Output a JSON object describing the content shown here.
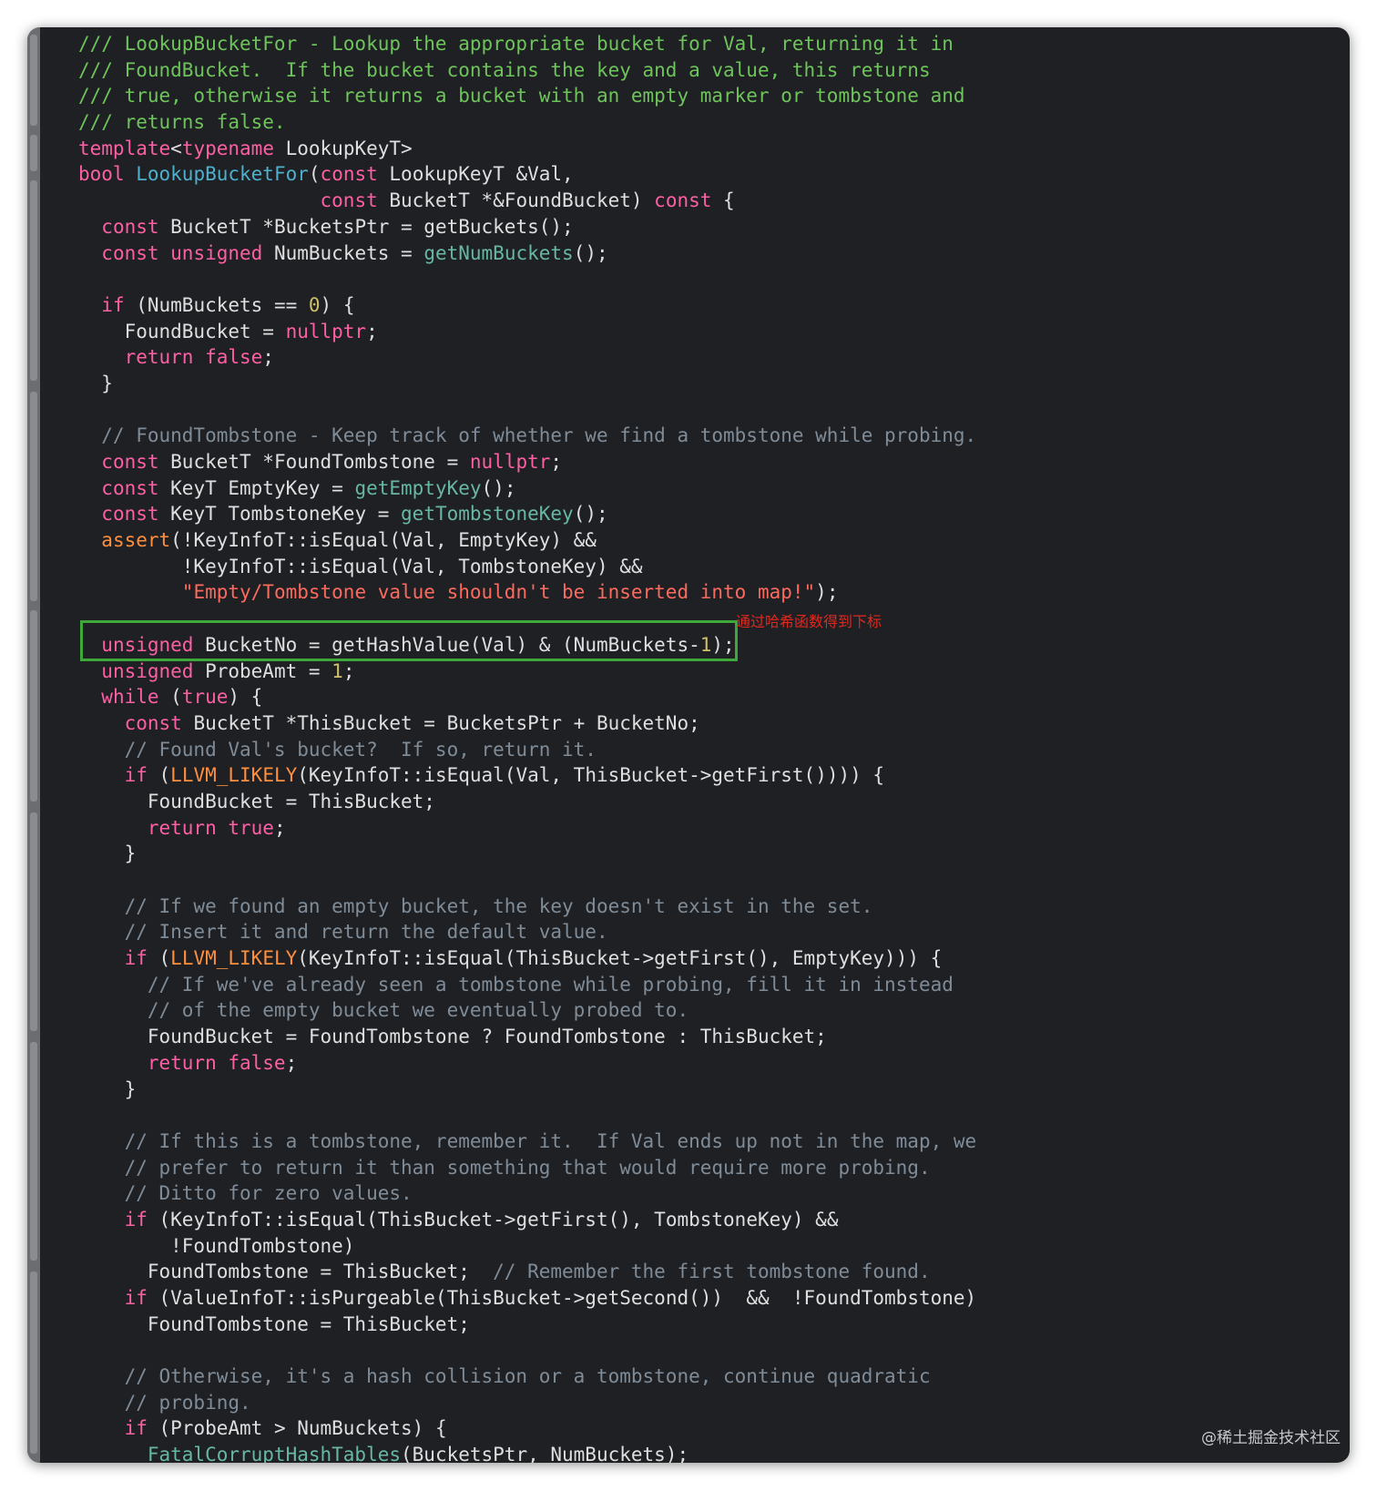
{
  "editor": {
    "annotation_label": "通过哈希函数得到下标",
    "watermark": "@稀土掘金技术社区",
    "highlighted_line_index": 23
  },
  "code_lines": [
    [
      [
        "doc",
        "/// LookupBucketFor - Lookup the appropriate bucket for Val, returning it in"
      ]
    ],
    [
      [
        "doc",
        "/// FoundBucket.  If the bucket contains the key and a value, this returns"
      ]
    ],
    [
      [
        "doc",
        "/// true, otherwise it returns a bucket with an empty marker or tombstone and"
      ]
    ],
    [
      [
        "doc",
        "/// returns false."
      ]
    ],
    [
      [
        "kw",
        "template"
      ],
      [
        "plain",
        "<"
      ],
      [
        "kw",
        "typename"
      ],
      [
        "plain",
        " LookupKeyT>"
      ]
    ],
    [
      [
        "kw",
        "bool"
      ],
      [
        "plain",
        " "
      ],
      [
        "fn",
        "LookupBucketFor"
      ],
      [
        "plain",
        "("
      ],
      [
        "kw",
        "const"
      ],
      [
        "plain",
        " LookupKeyT &Val,"
      ]
    ],
    [
      [
        "plain",
        "                     "
      ],
      [
        "kw",
        "const"
      ],
      [
        "plain",
        " BucketT *&FoundBucket) "
      ],
      [
        "kw",
        "const"
      ],
      [
        "plain",
        " {"
      ]
    ],
    [
      [
        "plain",
        "  "
      ],
      [
        "kw",
        "const"
      ],
      [
        "plain",
        " BucketT *BucketsPtr = getBuckets();"
      ]
    ],
    [
      [
        "plain",
        "  "
      ],
      [
        "kw",
        "const unsigned"
      ],
      [
        "plain",
        " NumBuckets = "
      ],
      [
        "call",
        "getNumBuckets"
      ],
      [
        "plain",
        "();"
      ]
    ],
    [
      [
        "plain",
        ""
      ]
    ],
    [
      [
        "plain",
        "  "
      ],
      [
        "kw",
        "if"
      ],
      [
        "plain",
        " (NumBuckets == "
      ],
      [
        "num",
        "0"
      ],
      [
        "plain",
        ") {"
      ]
    ],
    [
      [
        "plain",
        "    FoundBucket = "
      ],
      [
        "kw",
        "nullptr"
      ],
      [
        "plain",
        ";"
      ]
    ],
    [
      [
        "plain",
        "    "
      ],
      [
        "kw",
        "return false"
      ],
      [
        "plain",
        ";"
      ]
    ],
    [
      [
        "plain",
        "  }"
      ]
    ],
    [
      [
        "plain",
        ""
      ]
    ],
    [
      [
        "com",
        "  // FoundTombstone - Keep track of whether we find a tombstone while probing."
      ]
    ],
    [
      [
        "plain",
        "  "
      ],
      [
        "kw",
        "const"
      ],
      [
        "plain",
        " BucketT *FoundTombstone = "
      ],
      [
        "kw",
        "nullptr"
      ],
      [
        "plain",
        ";"
      ]
    ],
    [
      [
        "plain",
        "  "
      ],
      [
        "kw",
        "const"
      ],
      [
        "plain",
        " KeyT EmptyKey = "
      ],
      [
        "call",
        "getEmptyKey"
      ],
      [
        "plain",
        "();"
      ]
    ],
    [
      [
        "plain",
        "  "
      ],
      [
        "kw",
        "const"
      ],
      [
        "plain",
        " KeyT TombstoneKey = "
      ],
      [
        "call",
        "getTombstoneKey"
      ],
      [
        "plain",
        "();"
      ]
    ],
    [
      [
        "plain",
        "  "
      ],
      [
        "mac",
        "assert"
      ],
      [
        "plain",
        "(!KeyInfoT::isEqual(Val, EmptyKey) &&"
      ]
    ],
    [
      [
        "plain",
        "         !KeyInfoT::isEqual(Val, TombstoneKey) &&"
      ]
    ],
    [
      [
        "plain",
        "         "
      ],
      [
        "str",
        "\"Empty/Tombstone value shouldn't be inserted into map!\""
      ],
      [
        "plain",
        ");"
      ]
    ],
    [
      [
        "plain",
        ""
      ]
    ],
    [
      [
        "plain",
        "  "
      ],
      [
        "kw",
        "unsigned"
      ],
      [
        "plain",
        " BucketNo = getHashValue(Val) & (NumBuckets-"
      ],
      [
        "num",
        "1"
      ],
      [
        "plain",
        ");"
      ]
    ],
    [
      [
        "plain",
        "  "
      ],
      [
        "kw",
        "unsigned"
      ],
      [
        "plain",
        " ProbeAmt = "
      ],
      [
        "num",
        "1"
      ],
      [
        "plain",
        ";"
      ]
    ],
    [
      [
        "plain",
        "  "
      ],
      [
        "kw",
        "while"
      ],
      [
        "plain",
        " ("
      ],
      [
        "kw",
        "true"
      ],
      [
        "plain",
        ") {"
      ]
    ],
    [
      [
        "plain",
        "    "
      ],
      [
        "kw",
        "const"
      ],
      [
        "plain",
        " BucketT *ThisBucket = BucketsPtr + BucketNo;"
      ]
    ],
    [
      [
        "com",
        "    // Found Val's bucket?  If so, return it."
      ]
    ],
    [
      [
        "plain",
        "    "
      ],
      [
        "kw",
        "if"
      ],
      [
        "plain",
        " ("
      ],
      [
        "mac",
        "LLVM_LIKELY"
      ],
      [
        "plain",
        "(KeyInfoT::isEqual(Val, ThisBucket->getFirst()))) {"
      ]
    ],
    [
      [
        "plain",
        "      FoundBucket = ThisBucket;"
      ]
    ],
    [
      [
        "plain",
        "      "
      ],
      [
        "kw",
        "return true"
      ],
      [
        "plain",
        ";"
      ]
    ],
    [
      [
        "plain",
        "    }"
      ]
    ],
    [
      [
        "plain",
        ""
      ]
    ],
    [
      [
        "com",
        "    // If we found an empty bucket, the key doesn't exist in the set."
      ]
    ],
    [
      [
        "com",
        "    // Insert it and return the default value."
      ]
    ],
    [
      [
        "plain",
        "    "
      ],
      [
        "kw",
        "if"
      ],
      [
        "plain",
        " ("
      ],
      [
        "mac",
        "LLVM_LIKELY"
      ],
      [
        "plain",
        "(KeyInfoT::isEqual(ThisBucket->getFirst(), EmptyKey))) {"
      ]
    ],
    [
      [
        "com",
        "      // If we've already seen a tombstone while probing, fill it in instead"
      ]
    ],
    [
      [
        "com",
        "      // of the empty bucket we eventually probed to."
      ]
    ],
    [
      [
        "plain",
        "      FoundBucket = FoundTombstone ? FoundTombstone : ThisBucket;"
      ]
    ],
    [
      [
        "plain",
        "      "
      ],
      [
        "kw",
        "return false"
      ],
      [
        "plain",
        ";"
      ]
    ],
    [
      [
        "plain",
        "    }"
      ]
    ],
    [
      [
        "plain",
        ""
      ]
    ],
    [
      [
        "com",
        "    // If this is a tombstone, remember it.  If Val ends up not in the map, we"
      ]
    ],
    [
      [
        "com",
        "    // prefer to return it than something that would require more probing."
      ]
    ],
    [
      [
        "com",
        "    // Ditto for zero values."
      ]
    ],
    [
      [
        "plain",
        "    "
      ],
      [
        "kw",
        "if"
      ],
      [
        "plain",
        " (KeyInfoT::isEqual(ThisBucket->getFirst(), TombstoneKey) &&"
      ]
    ],
    [
      [
        "plain",
        "        !FoundTombstone)"
      ]
    ],
    [
      [
        "plain",
        "      FoundTombstone = ThisBucket;  "
      ],
      [
        "com",
        "// Remember the first tombstone found."
      ]
    ],
    [
      [
        "plain",
        "    "
      ],
      [
        "kw",
        "if"
      ],
      [
        "plain",
        " (ValueInfoT::isPurgeable(ThisBucket->getSecond())  &&  !FoundTombstone)"
      ]
    ],
    [
      [
        "plain",
        "      FoundTombstone = ThisBucket;"
      ]
    ],
    [
      [
        "plain",
        ""
      ]
    ],
    [
      [
        "com",
        "    // Otherwise, it's a hash collision or a tombstone, continue quadratic"
      ]
    ],
    [
      [
        "com",
        "    // probing."
      ]
    ],
    [
      [
        "plain",
        "    "
      ],
      [
        "kw",
        "if"
      ],
      [
        "plain",
        " (ProbeAmt > NumBuckets) {"
      ]
    ],
    [
      [
        "plain",
        "      "
      ],
      [
        "call",
        "FatalCorruptHashTables"
      ],
      [
        "plain",
        "(BucketsPtr, NumBuckets);"
      ]
    ]
  ]
}
